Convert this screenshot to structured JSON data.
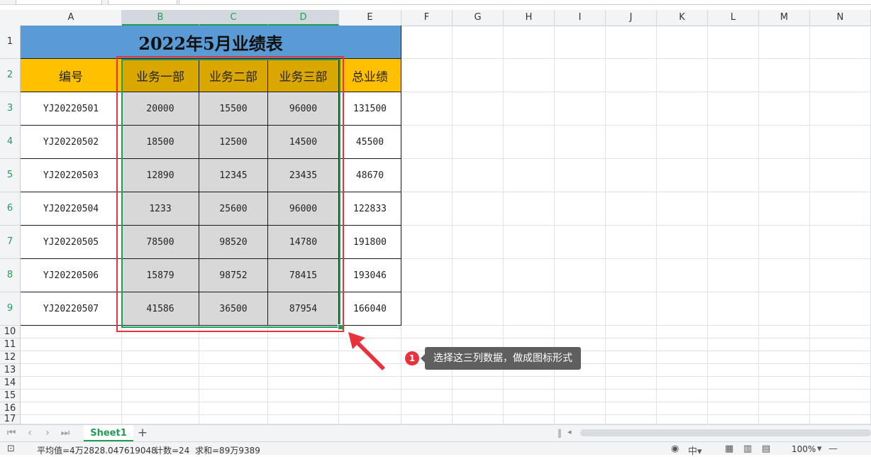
{
  "columns": [
    "A",
    "B",
    "C",
    "D",
    "E",
    "F",
    "G",
    "H",
    "I",
    "J",
    "K",
    "L",
    "M",
    "N"
  ],
  "selected_columns": [
    "B",
    "C",
    "D"
  ],
  "rows": [
    "1",
    "2",
    "3",
    "4",
    "5",
    "6",
    "7",
    "8",
    "9",
    "10",
    "11",
    "12",
    "13",
    "14",
    "15",
    "16",
    "17"
  ],
  "selected_rows": [
    "2",
    "3",
    "4",
    "5",
    "6",
    "7",
    "8",
    "9"
  ],
  "table": {
    "title": "2022年5月业绩表",
    "headers": [
      "编号",
      "业务一部",
      "业务二部",
      "业务三部",
      "总业绩"
    ],
    "rows": [
      [
        "YJ20220501",
        "20000",
        "15500",
        "96000",
        "131500"
      ],
      [
        "YJ20220502",
        "18500",
        "12500",
        "14500",
        "45500"
      ],
      [
        "YJ20220503",
        "12890",
        "12345",
        "23435",
        "48670"
      ],
      [
        "YJ20220504",
        "1233",
        "25600",
        "96000",
        "122833"
      ],
      [
        "YJ20220505",
        "78500",
        "98520",
        "14780",
        "191800"
      ],
      [
        "YJ20220506",
        "15879",
        "98752",
        "78415",
        "193046"
      ],
      [
        "YJ20220507",
        "41586",
        "36500",
        "87954",
        "166040"
      ]
    ]
  },
  "callout": {
    "badge": "1",
    "text": "选择这三列数据，做成图标形式"
  },
  "sheet_tab": "Sheet1",
  "status": {
    "average": "平均值=4万2828.047619048",
    "count": "计数=24",
    "sum": "求和=89万9389",
    "zoom": "100%"
  },
  "colors": {
    "title_bg": "#5b9bd5",
    "header_bg": "#ffc000",
    "selection": "#1f9d55",
    "highlight": "#e8323c"
  }
}
